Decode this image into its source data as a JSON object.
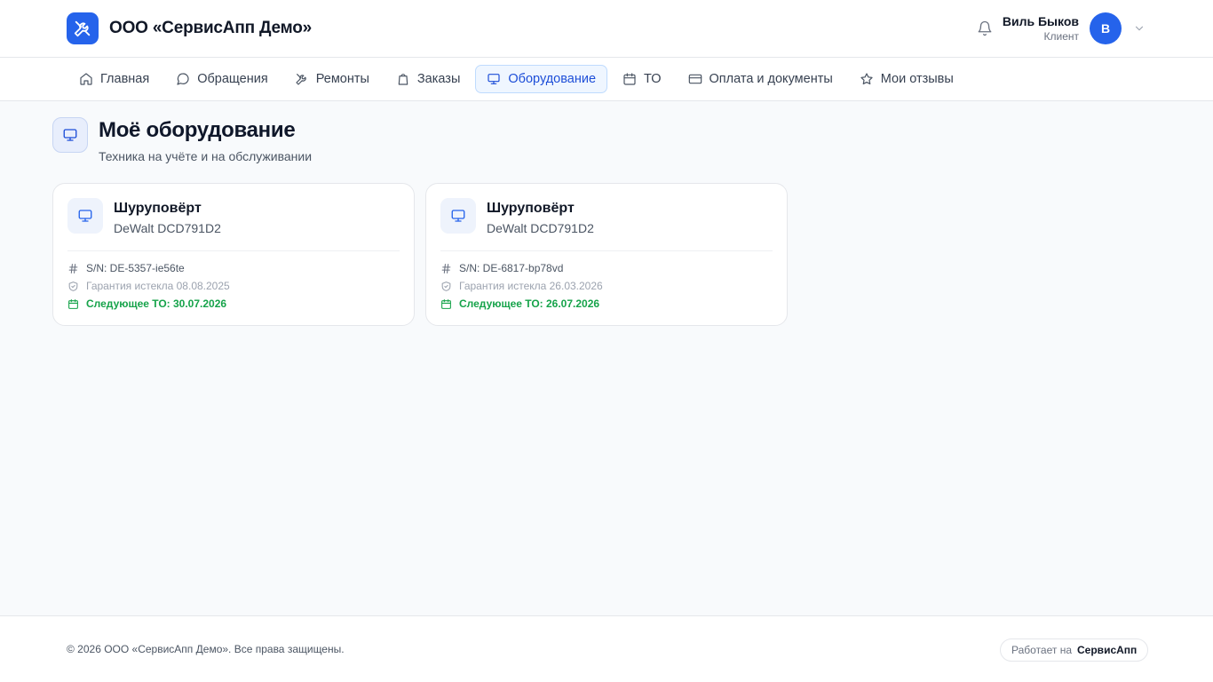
{
  "header": {
    "company": "ООО «СервисАпп Демо»",
    "user_name": "Виль Быков",
    "user_role": "Клиент",
    "avatar_initial": "В"
  },
  "nav": {
    "items": [
      {
        "label": "Главная",
        "icon": "home-icon"
      },
      {
        "label": "Обращения",
        "icon": "chat-icon"
      },
      {
        "label": "Ремонты",
        "icon": "tools-icon"
      },
      {
        "label": "Заказы",
        "icon": "bag-icon"
      },
      {
        "label": "Оборудование",
        "icon": "monitor-icon",
        "active": true
      },
      {
        "label": "ТО",
        "icon": "calendar-icon"
      },
      {
        "label": "Оплата и документы",
        "icon": "card-icon"
      },
      {
        "label": "Мои отзывы",
        "icon": "star-icon"
      }
    ]
  },
  "page": {
    "title": "Моё оборудование",
    "subtitle": "Техника на учёте и на обслуживании"
  },
  "equipment": [
    {
      "name": "Шуруповёрт",
      "model": "DeWalt DCD791D2",
      "serial": "S/N: DE-5357-ie56te",
      "warranty": "Гарантия истекла 08.08.2025",
      "next_service": "Следующее ТО: 30.07.2026"
    },
    {
      "name": "Шуруповёрт",
      "model": "DeWalt DCD791D2",
      "serial": "S/N: DE-6817-bp78vd",
      "warranty": "Гарантия истекла 26.03.2026",
      "next_service": "Следующее ТО: 26.07.2026"
    }
  ],
  "footer": {
    "copyright": "© 2026 ООО «СервисАпп Демо». Все права защищены.",
    "powered_prefix": "Работает на",
    "powered_brand": "СервисАпп"
  },
  "colors": {
    "accent": "#2563eb",
    "success": "#16a34a",
    "background": "#f8fafc"
  }
}
